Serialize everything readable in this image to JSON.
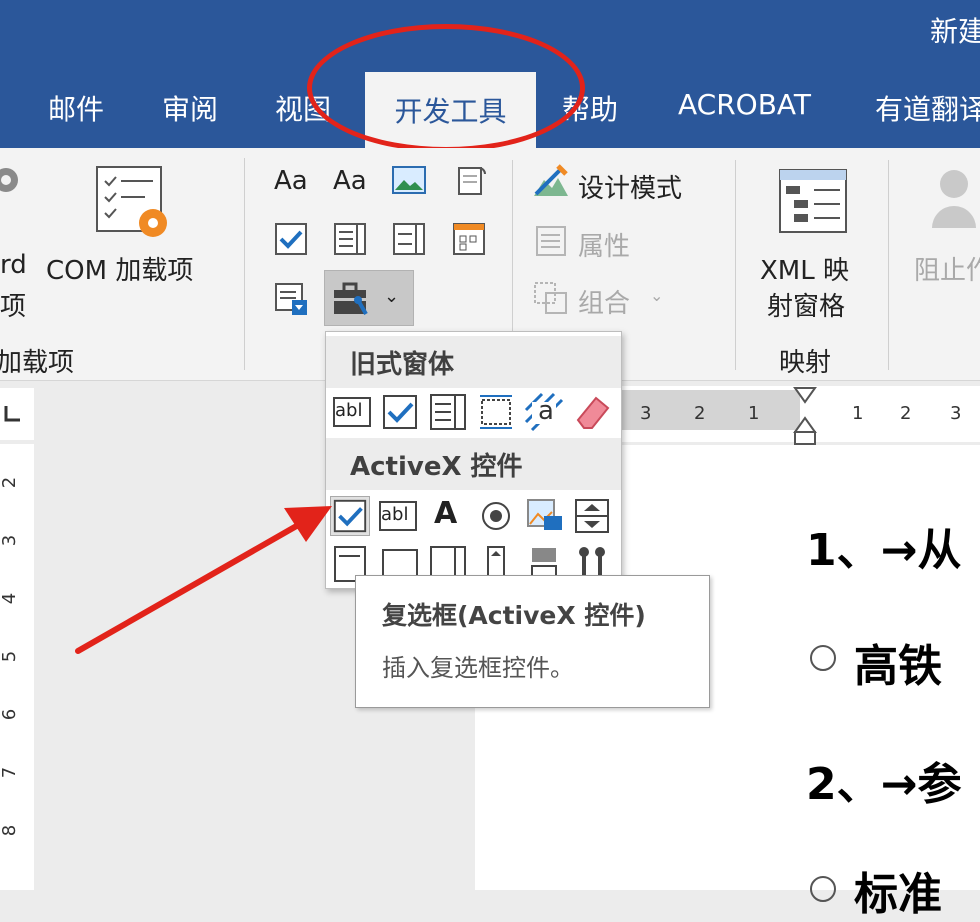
{
  "window": {
    "title": "新建"
  },
  "tabs": [
    {
      "label": "邮件"
    },
    {
      "label": "审阅"
    },
    {
      "label": "视图"
    },
    {
      "label": "开发工具",
      "active": true
    },
    {
      "label": "帮助"
    },
    {
      "label": "ACROBAT"
    },
    {
      "label": "有道翻译"
    }
  ],
  "ribbon": {
    "addins_group": {
      "word_addins_label_line1": "rd",
      "word_addins_label_line2": "载项",
      "com_addins_label": "COM 加载项",
      "group_label": "加载项"
    },
    "controls_group": {
      "design_mode": "设计模式",
      "properties": "属性",
      "group": "组合",
      "text_aa": "Aa",
      "plain_aa": "Aa"
    },
    "mapping_group": {
      "xml_line1": "XML 映",
      "xml_line2": "射窗格",
      "group_label": "映射"
    },
    "protect_group": {
      "label": "阻止作"
    }
  },
  "legacy_menu": {
    "legacy_header": "旧式窗体",
    "activex_header": "ActiveX 控件",
    "legacy_abl": "abl",
    "activex_abl": "abl",
    "label_a": "A",
    "legacy_a_icon": "a"
  },
  "tooltip": {
    "title": "复选框(ActiveX 控件)",
    "description": "插入复选框控件。"
  },
  "ruler": {
    "h_ticks": [
      "3",
      "2",
      "1",
      "1",
      "2",
      "3"
    ],
    "v_ticks": [
      "2",
      "3",
      "4",
      "5",
      "6",
      "7",
      "8"
    ]
  },
  "document": {
    "line1": "1、→从",
    "line2": "高铁",
    "line3": "2、→参",
    "line4": "标准"
  },
  "colors": {
    "ribbon_blue": "#2b579a",
    "highlight_red": "#e2231a",
    "checkbox_blue": "#1f6fbf",
    "gear_orange": "#f08a24"
  }
}
